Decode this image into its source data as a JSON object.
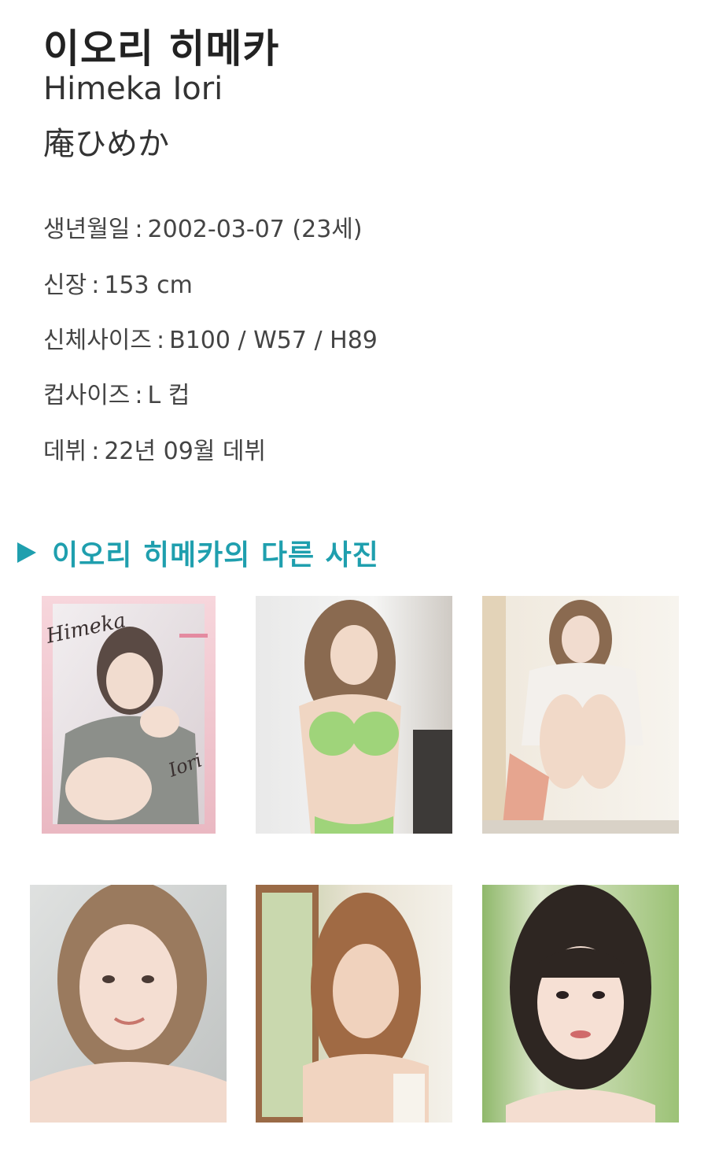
{
  "profile": {
    "name_ko": "이오리 히메카",
    "name_en": "Himeka Iori",
    "name_jp": "庵ひめか"
  },
  "info": [
    {
      "label": "생년월일",
      "value": "2002-03-07 (23세)"
    },
    {
      "label": "신장",
      "value": "153 cm"
    },
    {
      "label": "신체사이즈",
      "value": "B100 / W57 / H89"
    },
    {
      "label": "컵사이즈",
      "value": "L 컵"
    },
    {
      "label": "데뷔",
      "value": "22년 09월 데뷔"
    }
  ],
  "gallery": {
    "title": "이오리 히메카의 다른 사진",
    "accent_color": "#1f9fae",
    "card_texts": {
      "himeka": "Himeka",
      "iori": "Iori"
    }
  }
}
